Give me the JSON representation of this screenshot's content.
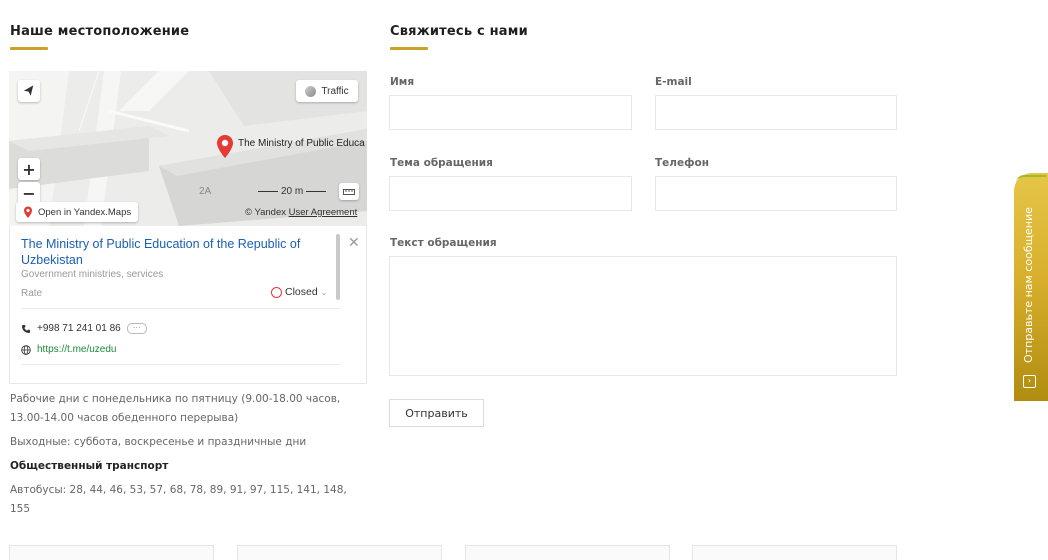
{
  "location": {
    "title": "Наше местоположение",
    "map": {
      "traffic_label": "Traffic",
      "pin_label": "The Ministry of Public Educa",
      "house_number": "2A",
      "scale_label": "20 m",
      "open_label": "Open in Yandex.Maps",
      "copyright": "© Yandex",
      "agreement": "User Agreement"
    },
    "card": {
      "name": "The Ministry of Public Education of the Republic of Uzbekistan",
      "category": "Government ministries, services",
      "rate_label": "Rate",
      "status": "Closed",
      "phone": "+998 71 241 01 86",
      "phone_more": "···",
      "website": "https://t.me/uzedu"
    },
    "workdays": "Рабочие дни с понедельника по пятницу (9.00-18.00 часов, 13.00-14.00 часов обеденного перерыва)",
    "weekend": "Выходные: суббота, воскресенье и праздничные дни",
    "transport_title": "Общественный транспорт",
    "buses": "Автобусы: 28, 44, 46, 53, 57, 68, 78, 89, 91, 97, 115, 141, 148, 155"
  },
  "contact": {
    "title": "Свяжитесь с нами",
    "name_label": "Имя",
    "email_label": "E-mail",
    "subject_label": "Тема обращения",
    "phone_label": "Телефон",
    "message_label": "Текст обращения",
    "submit_label": "Отправить"
  },
  "side_tab": {
    "label": "Отправьте нам сообщение"
  },
  "colors": {
    "accent": "#c9a227",
    "link": "#1a5fb4",
    "pin": "#e53935"
  }
}
